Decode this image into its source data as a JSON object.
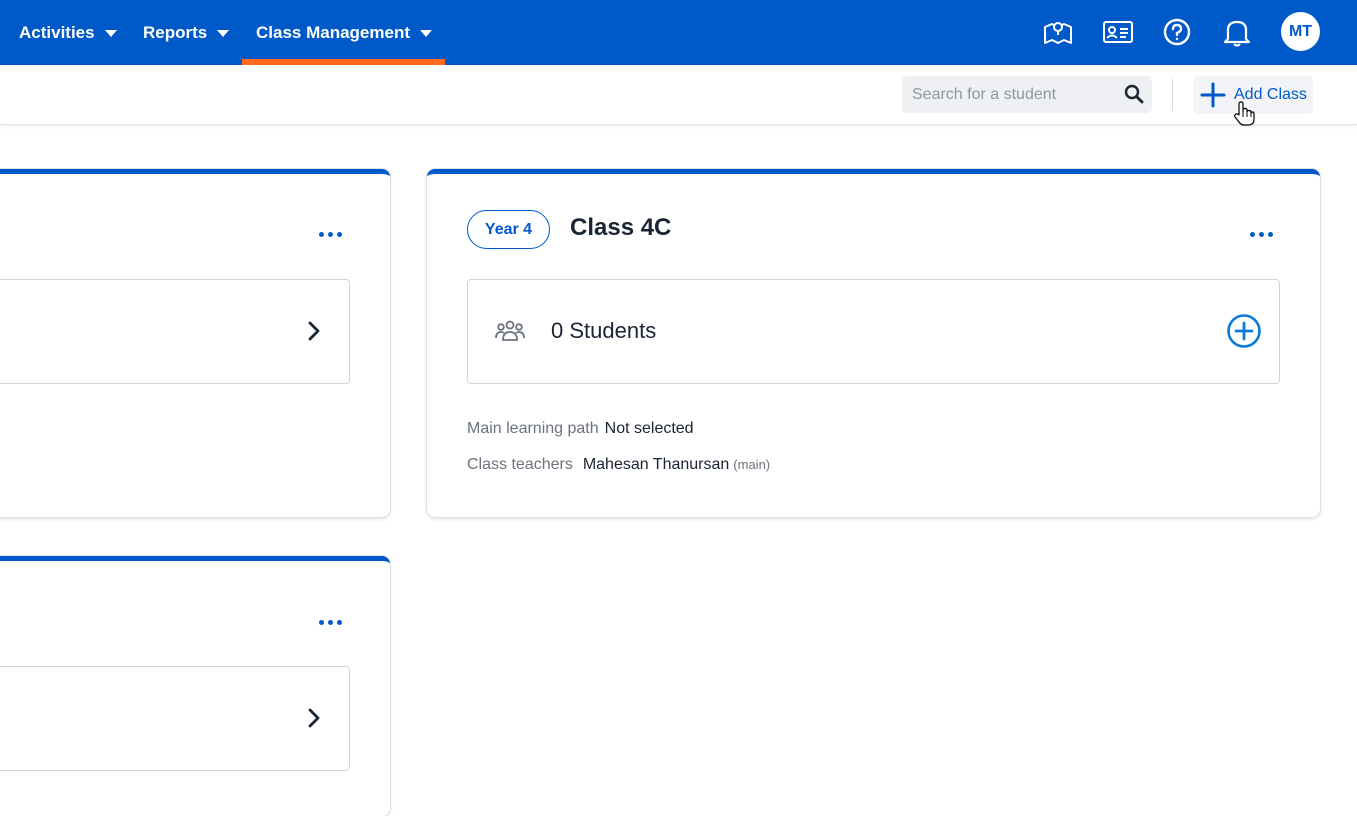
{
  "nav": {
    "items": [
      {
        "label": "Activities"
      },
      {
        "label": "Reports"
      },
      {
        "label": "Class Management"
      }
    ],
    "user_initials": "MT",
    "icons": [
      "map-icon",
      "id-card-icon",
      "help-icon",
      "bell-icon"
    ]
  },
  "toolbar": {
    "search_placeholder": "Search for a student",
    "add_class_label": "Add Class"
  },
  "class_card": {
    "year_badge": "Year 4",
    "title": "Class 4C",
    "students_label": "0 Students",
    "main_path_label": "Main learning path",
    "main_path_value": "Not selected",
    "teachers_label": "Class teachers",
    "teacher_name": "Mahesan Thanursan",
    "teacher_role": "(main)"
  },
  "colors": {
    "brand": "#0059c9",
    "active_tab": "#ff6b1a",
    "text": "#1b2433",
    "muted": "#6c737d"
  }
}
